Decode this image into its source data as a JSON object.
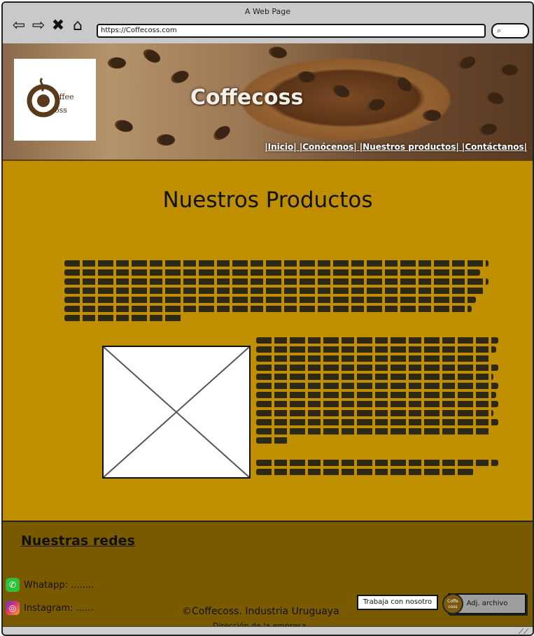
{
  "window": {
    "title": "A Web Page",
    "url": "https://Coffecoss.com"
  },
  "hero": {
    "logo_line1": "offee",
    "logo_line2": "oss",
    "brand": "Coffecoss",
    "menu": "|Inicio| |Conócenos| |Nuestros productos| |Contáctanos|"
  },
  "main": {
    "title": "Nuestros Productos"
  },
  "footer": {
    "redes_title": "Nuestras redes",
    "whatsapp_label": "Whatapp: ........",
    "instagram_label": "Instagram: ......",
    "copyright": "©Coffecoss. Industria Uruguaya",
    "address": "Dirección de la empresa",
    "trabaja_label": "Trabaja con nosotro",
    "mini_logo_text": "Coffe coss",
    "adj_label": "Adj. archivo"
  },
  "icons": {
    "back": "back-arrow-icon",
    "forward": "forward-arrow-icon",
    "close": "close-icon",
    "home": "home-icon",
    "search": "search-icon",
    "whatsapp": "whatsapp-icon",
    "instagram": "instagram-icon"
  },
  "colors": {
    "main_bg": "#bf8f00",
    "footer_bg": "#7a5a00",
    "brand_text": "#f4efe6"
  }
}
